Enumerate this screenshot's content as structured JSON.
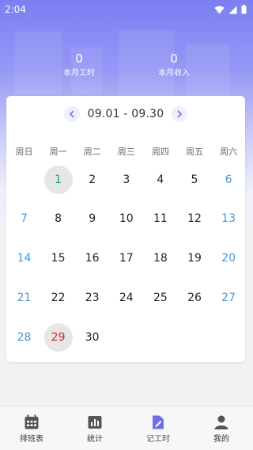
{
  "status_bar": {
    "time": "2:04"
  },
  "stats": {
    "hours_value": "0",
    "hours_label": "本月工时",
    "income_value": "0",
    "income_label": "本月收入"
  },
  "calendar": {
    "range": "09.01 - 09.30",
    "weekdays": [
      "周日",
      "周一",
      "周二",
      "周三",
      "周四",
      "周五",
      "周六"
    ],
    "weeks": [
      [
        "",
        "1",
        "2",
        "3",
        "4",
        "5",
        "6"
      ],
      [
        "7",
        "8",
        "9",
        "10",
        "11",
        "12",
        "13"
      ],
      [
        "14",
        "15",
        "16",
        "17",
        "18",
        "19",
        "20"
      ],
      [
        "21",
        "22",
        "23",
        "24",
        "25",
        "26",
        "27"
      ],
      [
        "28",
        "29",
        "30",
        "",
        "",
        "",
        ""
      ]
    ],
    "highlighted_green": "1",
    "highlighted_red": "29",
    "weekend_color": "#4a97d8",
    "green_color": "#2aa36b",
    "red_color": "#d22c2c"
  },
  "tabbar": {
    "tabs": [
      {
        "label": "排班表",
        "icon": "calendar-icon"
      },
      {
        "label": "统计",
        "icon": "bar-chart-icon"
      },
      {
        "label": "记工时",
        "icon": "edit-note-icon"
      },
      {
        "label": "我的",
        "icon": "person-icon"
      }
    ],
    "active_index": 2,
    "active_color": "#6f6fe8"
  }
}
